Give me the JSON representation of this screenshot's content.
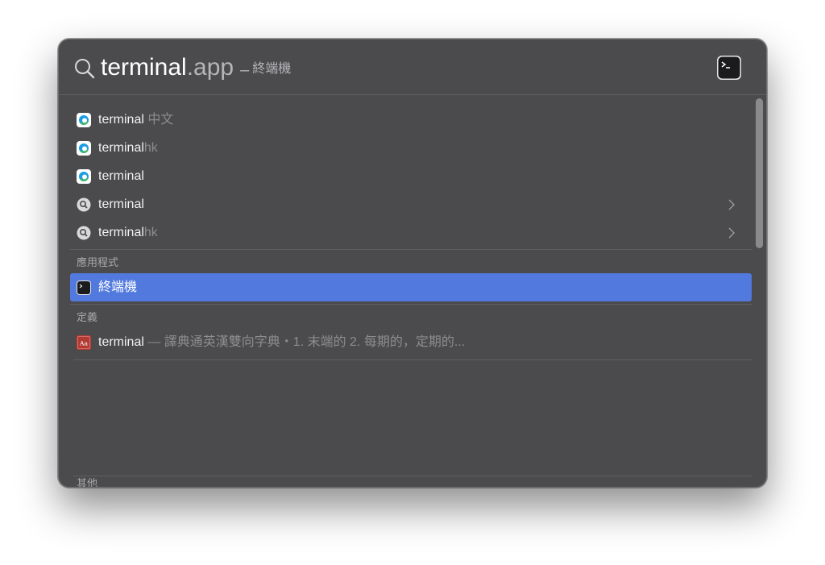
{
  "search": {
    "query": "terminal",
    "completion": ".app",
    "dash": "–",
    "subtitle": "終端機"
  },
  "suggestions": [
    {
      "text": "terminal",
      "muted": " 中文",
      "icon": "edge-browser-icon",
      "chevron": false
    },
    {
      "text": "terminal",
      "muted": "hk",
      "icon": "edge-browser-icon",
      "chevron": false
    },
    {
      "text": "terminal",
      "muted": "",
      "icon": "edge-browser-icon",
      "chevron": false
    },
    {
      "text": "terminal",
      "muted": "",
      "icon": "search-suggestion-icon",
      "chevron": true
    },
    {
      "text": "terminal",
      "muted": "hk",
      "icon": "search-suggestion-icon",
      "chevron": true
    }
  ],
  "applications": {
    "header": "應用程式",
    "items": [
      {
        "text": "終端機",
        "icon": "terminal-app-icon",
        "selected": true
      }
    ]
  },
  "definitions": {
    "header": "定義",
    "items": [
      {
        "text": "terminal",
        "muted": " — 譯典通英漢雙向字典・1. 末端的 2. 每期的，定期的...",
        "icon": "dictionary-icon"
      }
    ]
  },
  "other": {
    "header": "其他"
  },
  "colors": {
    "panel": "#4b4a4d",
    "selection": "#5279dd"
  }
}
